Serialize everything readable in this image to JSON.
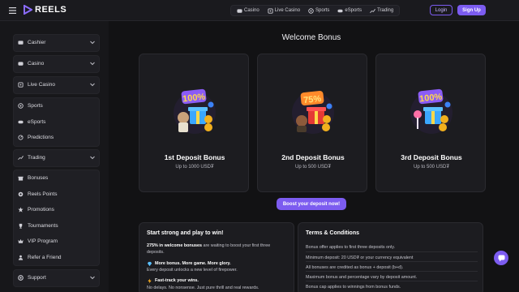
{
  "header": {
    "logo_text": "REELS",
    "nav": [
      {
        "label": "Casino",
        "icon": "casino-icon"
      },
      {
        "label": "Live Casino",
        "icon": "live-casino-icon"
      },
      {
        "label": "Sports",
        "icon": "sports-icon"
      },
      {
        "label": "eSports",
        "icon": "esports-icon"
      },
      {
        "label": "Trading",
        "icon": "trading-icon"
      }
    ],
    "login_label": "Login",
    "signup_label": "Sign Up"
  },
  "sidebar": {
    "groups": [
      {
        "items": [
          {
            "label": "Cashier",
            "icon": "wallet-icon",
            "chevron": true
          }
        ]
      },
      {
        "items": [
          {
            "label": "Casino",
            "icon": "casino-icon",
            "chevron": true
          }
        ]
      },
      {
        "items": [
          {
            "label": "Live Casino",
            "icon": "live-casino-icon",
            "chevron": true
          }
        ]
      },
      {
        "items": [
          {
            "label": "Sports",
            "icon": "sports-icon"
          },
          {
            "label": "eSports",
            "icon": "esports-icon"
          },
          {
            "label": "Predictions",
            "icon": "predictions-icon"
          }
        ]
      },
      {
        "items": [
          {
            "label": "Trading",
            "icon": "trading-icon",
            "chevron": true
          }
        ]
      },
      {
        "items": [
          {
            "label": "Bonuses",
            "icon": "bonus-icon"
          },
          {
            "label": "Reels Points",
            "icon": "points-icon"
          },
          {
            "label": "Promotions",
            "icon": "promotions-icon"
          },
          {
            "label": "Tournaments",
            "icon": "trophy-icon"
          },
          {
            "label": "VIP Program",
            "icon": "crown-icon"
          },
          {
            "label": "Refer a Friend",
            "icon": "refer-icon"
          }
        ]
      },
      {
        "items": [
          {
            "label": "Support",
            "icon": "support-icon",
            "chevron": true
          }
        ]
      }
    ]
  },
  "main": {
    "title": "Welcome Bonus",
    "cards": [
      {
        "badge": "100%",
        "title": "1st Deposit Bonus",
        "subtitle": "Up to 1000 USD₮"
      },
      {
        "badge": "75%",
        "title": "2nd Deposit Bonus",
        "subtitle": "Up to 500 USD₮"
      },
      {
        "badge": "100%",
        "title": "3rd Deposit Bonus",
        "subtitle": "Up to 500 USD₮"
      }
    ],
    "boost_label": "Boost your deposit now!",
    "info_panel": {
      "title": "Start strong and play to win!",
      "intro_bold": "275% in welcome bonuses",
      "intro_rest": " are waiting to boost your first three deposits.",
      "point1_title": "More bonus. More game. More glory.",
      "point1_text": "Every deposit unlocks a new level of firepower.",
      "point2_title": "Fast-track your wins.",
      "point2_text": "No delays. No nonsense. Just pure thrill and real rewards."
    },
    "terms_panel": {
      "title": "Terms & Conditions",
      "items": [
        "Bonus offer applies to first three deposits only.",
        "Minimum deposit: 20 USD₮ or your currency equivalent",
        "All bonuses are credited as bonus + deposit (b+d).",
        "Maximum bonus and percentage vary by deposit amount.",
        "Bonus cap applies to winnings from bonus funds."
      ]
    }
  },
  "colors": {
    "accent": "#7c5cf0",
    "background": "#121214",
    "card": "#1c1c20"
  }
}
